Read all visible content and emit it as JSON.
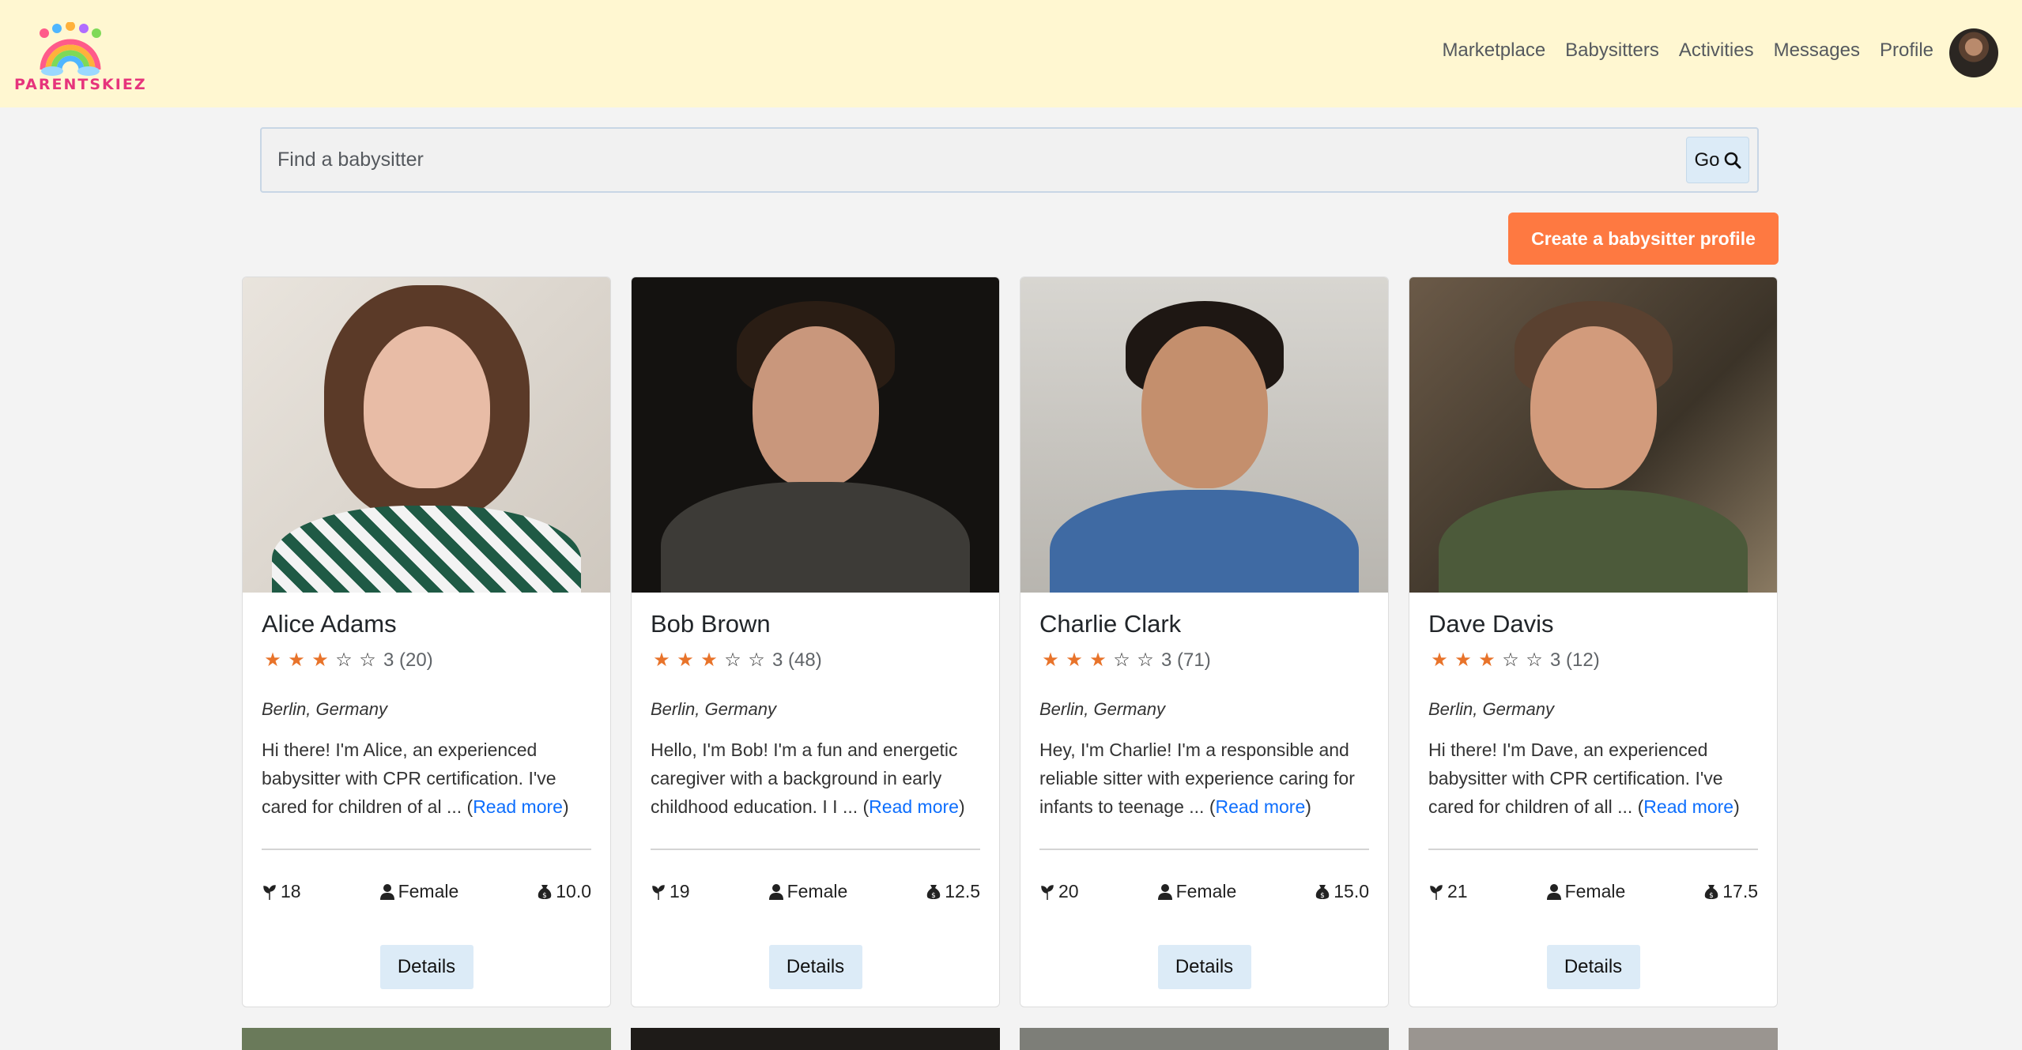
{
  "brand": {
    "name": "PARENTSKIEZ"
  },
  "nav": {
    "items": [
      "Marketplace",
      "Babysitters",
      "Activities",
      "Messages",
      "Profile"
    ]
  },
  "search": {
    "placeholder": "Find a babysitter",
    "go_label": "Go"
  },
  "create_button": "Create a babysitter profile",
  "cards": [
    {
      "name": "Alice Adams",
      "rating": 3,
      "reviews": "3 (20)",
      "location": "Berlin, Germany",
      "bio": "Hi there! I'm Alice, an experienced babysitter with CPR certification. I've cared for children of al ... (",
      "read_more": "Read more",
      "bio_end": ")",
      "age": "18",
      "gender": "Female",
      "rate": "10.0",
      "details": "Details"
    },
    {
      "name": "Bob Brown",
      "rating": 3,
      "reviews": "3 (48)",
      "location": "Berlin, Germany",
      "bio": "Hello, I'm Bob! I'm a fun and energetic caregiver with a background in early childhood education. I I ... (",
      "read_more": "Read more",
      "bio_end": ")",
      "age": "19",
      "gender": "Female",
      "rate": "12.5",
      "details": "Details"
    },
    {
      "name": "Charlie Clark",
      "rating": 3,
      "reviews": "3 (71)",
      "location": "Berlin, Germany",
      "bio": "Hey, I'm Charlie! I'm a responsible and reliable sitter with experience caring for infants to teenage ... (",
      "read_more": "Read more",
      "bio_end": ")",
      "age": "20",
      "gender": "Female",
      "rate": "15.0",
      "details": "Details"
    },
    {
      "name": "Dave Davis",
      "rating": 3,
      "reviews": "3 (12)",
      "location": "Berlin, Germany",
      "bio": "Hi there! I'm Dave, an experienced babysitter with CPR certification. I've cared for children of all ... (",
      "read_more": "Read more",
      "bio_end": ")",
      "age": "21",
      "gender": "Female",
      "rate": "17.5",
      "details": "Details"
    }
  ],
  "colors": {
    "navbar_bg": "#fff7d1",
    "accent": "#fe7941",
    "star": "#e8732a",
    "link": "#0d6efd",
    "button_bg": "#dcebf7"
  }
}
